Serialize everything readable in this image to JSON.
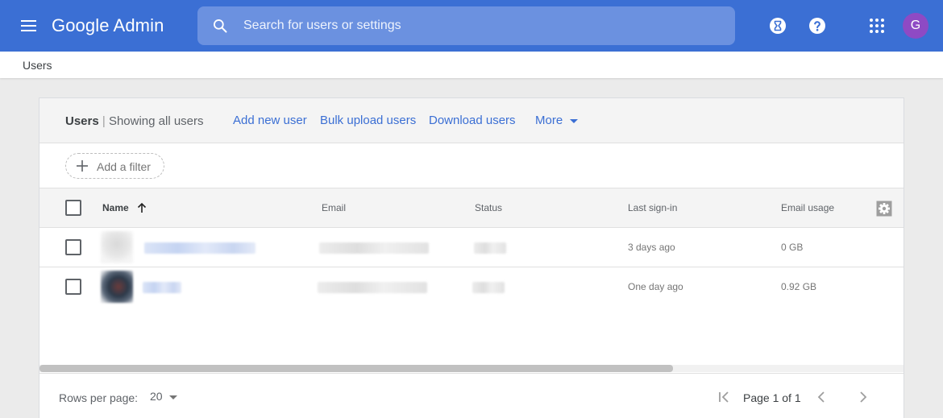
{
  "app": {
    "title": "Google Admin",
    "search_placeholder": "Search for users or settings",
    "avatar_initial": "G",
    "colors": {
      "topbar": "#3b6fd4",
      "link": "#3b6fd4",
      "avatar": "#8e4ac4"
    }
  },
  "icons": {
    "menu": "hamburger-menu-icon",
    "search": "search-icon",
    "help_alt": "hourglass-icon",
    "help": "help-icon",
    "apps": "apps-grid-icon"
  },
  "breadcrumb": {
    "current": "Users"
  },
  "toolbar": {
    "title": "Users",
    "separator": "|",
    "subtitle": "Showing all users",
    "add_user": "Add new user",
    "bulk_upload": "Bulk upload users",
    "download": "Download users",
    "more": "More"
  },
  "filter": {
    "label": "Add a filter"
  },
  "table": {
    "columns": [
      "Name",
      "Email",
      "Status",
      "Last sign-in",
      "Email usage"
    ],
    "sort": "ascending",
    "rows": [
      {
        "last_signin": "3 days ago",
        "email_usage": "0 GB"
      },
      {
        "last_signin": "One day ago",
        "email_usage": "0.92 GB"
      }
    ]
  },
  "pagination": {
    "rows_per_page_label": "Rows per page:",
    "rows_per_page": "20",
    "page_text": "Page 1 of 1"
  }
}
